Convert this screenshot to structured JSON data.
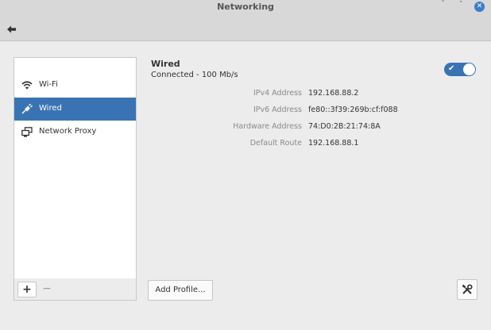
{
  "window": {
    "title": "Networking",
    "minimize_glyph": "ˇ",
    "maximize_glyph": "˄",
    "close_glyph": "✕"
  },
  "sidebar": {
    "items": [
      {
        "label": "Wi-Fi",
        "icon": "wifi-icon",
        "selected": false
      },
      {
        "label": "Wired",
        "icon": "wired-plug-icon",
        "selected": true
      },
      {
        "label": "Network Proxy",
        "icon": "network-proxy-icon",
        "selected": false
      }
    ],
    "add_label": "+",
    "remove_label": "−"
  },
  "connection": {
    "title": "Wired",
    "status": "Connected - 100 Mb/s",
    "enabled": true,
    "details": [
      {
        "label": "IPv4 Address",
        "value": "192.168.88.2"
      },
      {
        "label": "IPv6 Address",
        "value": "fe80::3f39:269b:cf:f088"
      },
      {
        "label": "Hardware Address",
        "value": "74:D0:2B:21:74:8A"
      },
      {
        "label": "Default Route",
        "value": "192.168.88.1"
      }
    ]
  },
  "footer": {
    "add_profile_label": "Add Profile..."
  },
  "colors": {
    "accent": "#3a73b3",
    "close_button": "#3d7ccc"
  }
}
